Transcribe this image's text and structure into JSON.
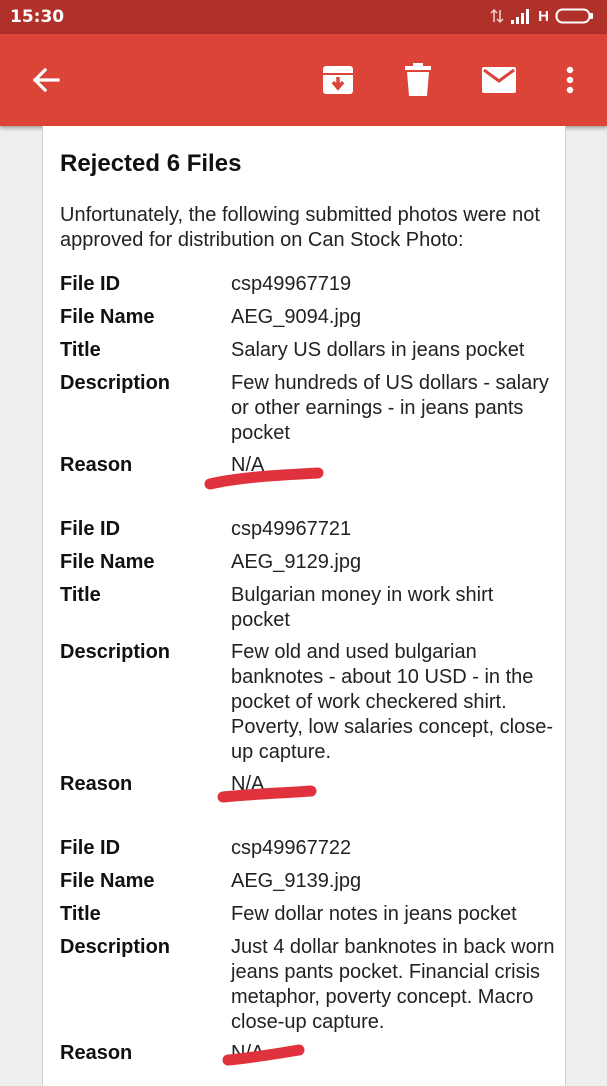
{
  "status_bar": {
    "time": "15:30",
    "network": "H"
  },
  "app_bar": {
    "icons": [
      "back-arrow-icon",
      "archive-icon",
      "delete-icon",
      "mail-icon",
      "more-vert-icon"
    ]
  },
  "email": {
    "heading": "Rejected 6 Files",
    "intro": "Unfortunately, the following submitted photos were not approved for distribution on Can Stock Photo:",
    "labels": {
      "file_id": "File ID",
      "file_name": "File Name",
      "title": "Title",
      "description": "Description",
      "reason": "Reason"
    },
    "files": [
      {
        "file_id": "csp49967719",
        "file_name": "AEG_9094.jpg",
        "title": "Salary US dollars in jeans pocket",
        "description": "Few hundreds of US dollars - salary or other earnings - in jeans pants pocket",
        "reason": "N/A"
      },
      {
        "file_id": "csp49967721",
        "file_name": "AEG_9129.jpg",
        "title": "Bulgarian money in work shirt pocket",
        "description": "Few old and used bulgarian banknotes - about 10 USD - in the pocket of work checkered shirt. Poverty, low salaries concept, close-up capture.",
        "reason": "N/A"
      },
      {
        "file_id": "csp49967722",
        "file_name": "AEG_9139.jpg",
        "title": "Few dollar notes in jeans pocket",
        "description": "Just 4 dollar banknotes in back worn jeans pants pocket. Financial crisis metaphor, poverty concept. Macro close-up capture.",
        "reason": "N/A"
      }
    ]
  },
  "colors": {
    "status_bar": "#b0302a",
    "app_bar": "#db4437",
    "annotation_stroke": "#e0323c"
  }
}
